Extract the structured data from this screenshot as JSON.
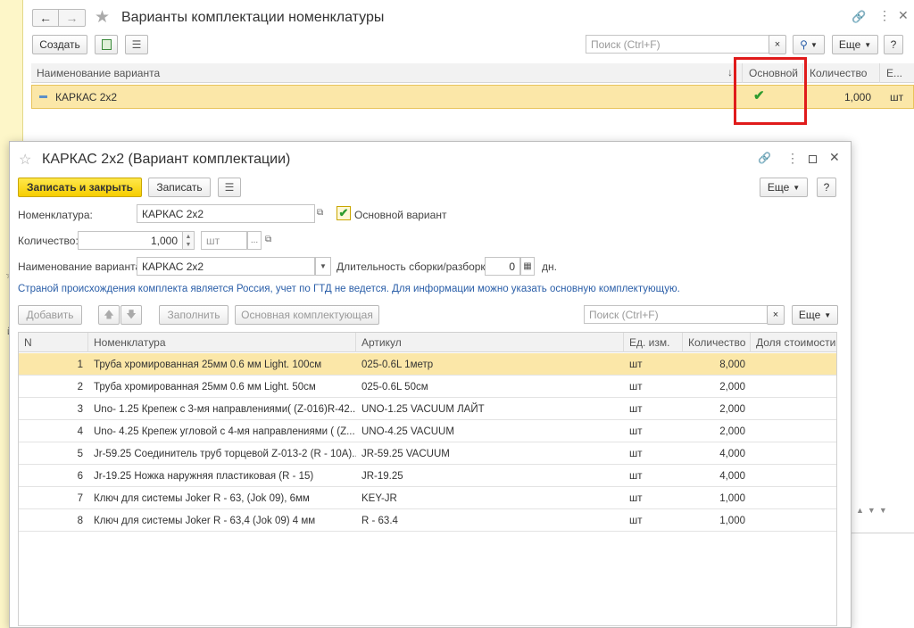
{
  "main_window": {
    "title": "Варианты комплектации номенклатуры",
    "create_label": "Создать",
    "search_placeholder": "Поиск (Ctrl+F)",
    "more_label": "Еще",
    "help_label": "?",
    "columns": [
      "Наименование варианта",
      "Основной",
      "Количество",
      "Е..."
    ],
    "row": {
      "name": "КАРКАС 2х2",
      "main": true,
      "quantity": "1,000",
      "unit": "шт"
    }
  },
  "dialog": {
    "title": "КАРКАС 2х2 (Вариант комплектации)",
    "save_close_label": "Записать и закрыть",
    "save_label": "Записать",
    "more_label": "Еще",
    "help_label": "?",
    "nomenclature_label": "Номенклатура:",
    "nomenclature_value": "КАРКАС 2х2",
    "main_variant_label": "Основной вариант",
    "main_variant_checked": true,
    "quantity_label": "Количество:",
    "quantity_value": "1,000",
    "unit_value": "шт",
    "variant_name_label": "Наименование варианта:",
    "variant_name_value": "КАРКАС 2х2",
    "duration_label": "Длительность сборки/разборки:",
    "duration_value": "0",
    "duration_unit": "дн.",
    "info_text": "Страной происхождения комплекта является Россия, учет по ГТД не ведется. Для информации можно указать основную комплектующую.",
    "add_label": "Добавить",
    "fill_label": "Заполнить",
    "main_component_label": "Основная комплектующая",
    "search_placeholder": "Поиск (Ctrl+F)",
    "table_more_label": "Еще",
    "columns": [
      "N",
      "Номенклатура",
      "Артикул",
      "Ед. изм.",
      "Количество",
      "Доля стоимости"
    ],
    "rows": [
      {
        "n": "1",
        "name": "Труба хромированная  25мм 0.6 мм Light. 100см",
        "article": "025-0.6L 1метр",
        "unit": "шт",
        "qty": "8,000"
      },
      {
        "n": "2",
        "name": "Труба хромированная  25мм 0.6 мм Light. 50см",
        "article": "025-0.6L 50см",
        "unit": "шт",
        "qty": "2,000"
      },
      {
        "n": "3",
        "name": "Uno- 1.25 Крепеж с 3-мя направлениями( (Z-016)R-42...",
        "article": "UNO-1.25 VACUUM ЛАЙТ",
        "unit": "шт",
        "qty": "2,000"
      },
      {
        "n": "4",
        "name": "Uno- 4.25 Крепеж угловой с 4-мя направлениями ( (Z...",
        "article": "UNO-4.25 VACUUM",
        "unit": "шт",
        "qty": "2,000"
      },
      {
        "n": "5",
        "name": "Jr-59.25 Соединитель труб торцевой Z-013-2 (R - 10A)...",
        "article": "JR-59.25 VACUUM",
        "unit": "шт",
        "qty": "4,000"
      },
      {
        "n": "6",
        "name": "Jr-19.25 Ножка наружняя пластиковая (R - 15)",
        "article": "JR-19.25",
        "unit": "шт",
        "qty": "4,000"
      },
      {
        "n": "7",
        "name": "Ключ для системы Joker R - 63, (Jok 09), 6мм",
        "article": "KEY-JR",
        "unit": "шт",
        "qty": "1,000"
      },
      {
        "n": "8",
        "name": "Ключ для системы Joker R - 63,4 (Jok 09) 4 мм",
        "article": "R - 63.4",
        "unit": "шт",
        "qty": "1,000"
      }
    ]
  },
  "colors": {
    "accent_yellow": "#f6cd00",
    "selected_row": "#fbe7a8",
    "highlight_red": "#e01b1b",
    "check_green": "#2e9b2e",
    "info_blue": "#2a5ea8"
  },
  "icons": [
    "back-arrow-icon",
    "forward-arrow-icon",
    "star-icon",
    "link-icon",
    "kebab-icon",
    "close-icon",
    "maximize-icon",
    "search-icon",
    "list-icon",
    "copy-icon",
    "check-icon"
  ]
}
